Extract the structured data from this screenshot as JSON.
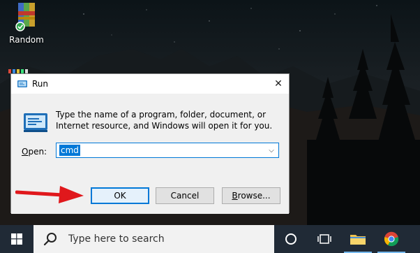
{
  "desktop": {
    "icons": [
      {
        "label": "Random",
        "icon": "winrar-archive-icon"
      }
    ]
  },
  "run_dialog": {
    "title": "Run",
    "title_icon": "run-icon",
    "close_glyph": "✕",
    "instruction": "Type the name of a program, folder, document, or Internet resource, and Windows will open it for you.",
    "open_label_accel": "O",
    "open_label_rest": "pen:",
    "open_value": "cmd",
    "dropdown_glyph": "⌵",
    "buttons": {
      "ok": "OK",
      "cancel": "Cancel",
      "browse_accel": "B",
      "browse_rest": "rowse..."
    },
    "accent_color": "#0078d7"
  },
  "annotation": {
    "arrow_color": "#e0181c",
    "points_to": "ok-button"
  },
  "taskbar": {
    "start_icon": "windows-logo-icon",
    "search_placeholder": "Type here to search",
    "search_icon": "search-icon",
    "items": [
      {
        "name": "cortana",
        "icon": "cortana-icon"
      },
      {
        "name": "task-view",
        "icon": "task-view-icon"
      },
      {
        "name": "file-explorer",
        "icon": "folder-icon"
      },
      {
        "name": "chrome",
        "icon": "chrome-icon"
      }
    ],
    "background": "#202a36"
  }
}
